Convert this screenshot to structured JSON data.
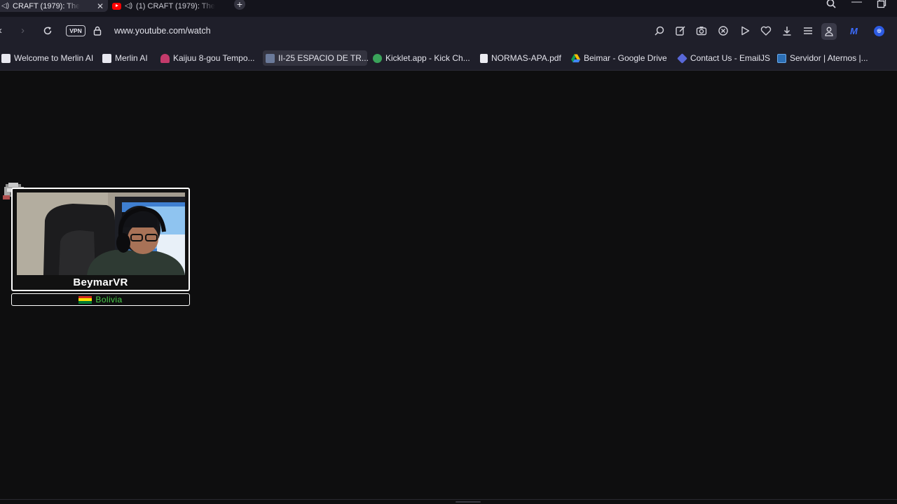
{
  "tabs": [
    {
      "title": "CRAFT (1979): The",
      "active": true,
      "audio": true
    },
    {
      "title": "(1) CRAFT (1979): The",
      "active": false,
      "audio": true
    }
  ],
  "address_bar": {
    "vpn_label": "VPN",
    "url": "www.youtube.com/watch"
  },
  "bookmarks": [
    "Welcome to Merlin AI",
    "Merlin AI",
    "Kaijuu 8-gou Tempo...",
    "II-25 ESPACIO DE TR...",
    "Kicklet.app - Kick Ch...",
    "NORMAS-APA.pdf",
    "Beimar - Google Drive",
    "Contact Us - EmailJS",
    "Servidor | Aternos |..."
  ],
  "overlay": {
    "streamer_name": "BeymarVR",
    "country": "Bolivia",
    "country_color": "#4bd04b",
    "flag_colors": [
      "#d52b1e",
      "#f9e300",
      "#007934"
    ]
  },
  "icons": {
    "toolbar": [
      "search-icon",
      "edit-icon",
      "camera-icon",
      "shield-icon",
      "play-icon",
      "heart-icon",
      "download-icon",
      "menu-icon",
      "profile-icon"
    ]
  }
}
